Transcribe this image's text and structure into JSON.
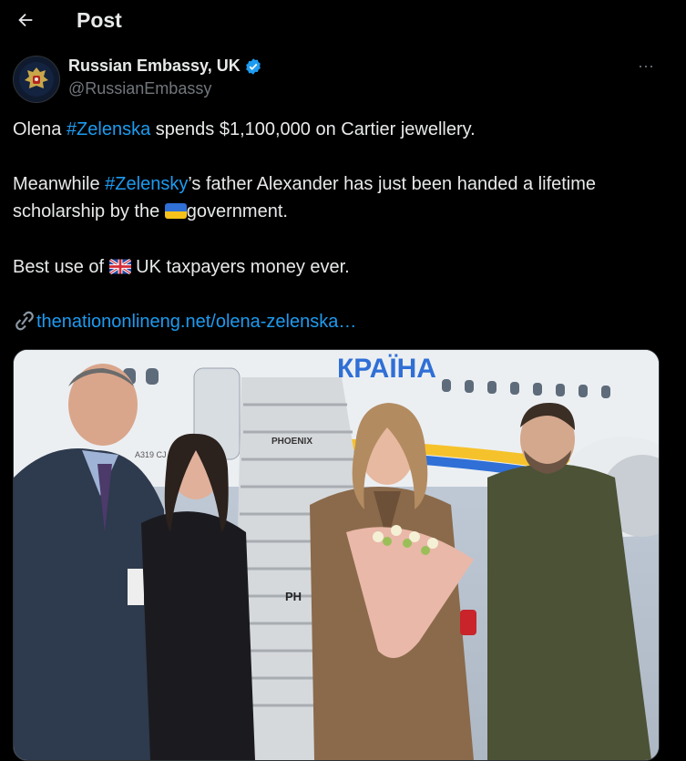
{
  "header": {
    "title": "Post",
    "back_icon": "arrow-left-icon"
  },
  "author": {
    "display_name": "Russian Embassy, UK",
    "handle": "@RussianEmbassy",
    "verified_icon": "verified-badge-icon",
    "verified_color": "#1d9bf0",
    "avatar_icon": "coat-of-arms-icon"
  },
  "more_label": "···",
  "tweet": {
    "line1": {
      "pre": "Olena ",
      "hashtag": "#Zelenska",
      "post": " spends $1,100,000 on Cartier jewellery."
    },
    "line2": {
      "pre": "Meanwhile ",
      "hashtag": "#Zelensky",
      "post": "’s father Alexander has just been handed a lifetime"
    },
    "line3": {
      "pre": "scholarship by the ",
      "post": "government."
    },
    "line4": {
      "pre": "Best use of ",
      "post": " UK taxpayers money ever."
    },
    "link": "thenationonlineng.net/olena-zelenska…"
  },
  "media": {
    "plane_text": "КРАЇНА",
    "stair_text_1": "PHOENIX",
    "stair_text_2": "PH",
    "plane_code": "A319 CJ"
  },
  "colors": {
    "link": "#1d9bf0",
    "text": "#e7e9ea",
    "muted": "#71767b",
    "bg": "#000000"
  }
}
